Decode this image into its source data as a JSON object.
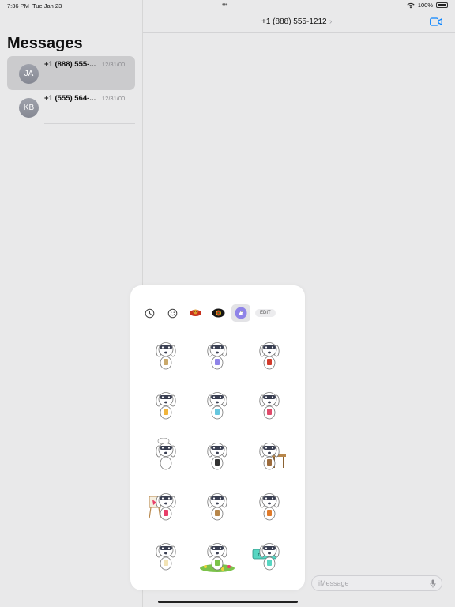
{
  "status_bar": {
    "time": "7:36 PM",
    "date": "Tue Jan 23",
    "battery": "100%",
    "battery_level": 1.0
  },
  "sidebar": {
    "title": "Messages",
    "conversations": [
      {
        "initials": "JA",
        "name": "+1 (888) 555-...",
        "date": "12/31/00",
        "selected": true
      },
      {
        "initials": "KB",
        "name": "+1 (555) 564-...",
        "date": "12/31/00",
        "selected": false
      }
    ]
  },
  "chat": {
    "title": "+1 (888) 555-1212"
  },
  "sticker_drawer": {
    "tabs": [
      "recents-icon",
      "emoji-icon",
      "sticker-pack-red-icon",
      "sticker-pack-eye-icon",
      "sticker-pack-dog-icon"
    ],
    "active_tab": 4,
    "edit_label": "EDIT",
    "stickers": [
      "dog-reading-map-sticker",
      "dog-reading-book-sticker",
      "dog-superhero-cape-sticker",
      "dog-waving-sticker",
      "dog-holding-bubble-sticker",
      "dog-with-gift-sticker",
      "dog-chef-sticker",
      "dog-in-suit-sticker",
      "dog-at-desk-sticker",
      "dog-painter-sticker",
      "dog-guitar-sticker",
      "dog-basketball-sticker",
      "dog-holding-card-sticker",
      "dog-in-flowers-sticker",
      "dog-with-sign-sticker"
    ],
    "sign_text": "TODAY!"
  },
  "input": {
    "placeholder": "iMessage"
  },
  "colors": {
    "accent": "#0a84ff",
    "background": "#e9e9ea",
    "popover": "#ffffff"
  }
}
